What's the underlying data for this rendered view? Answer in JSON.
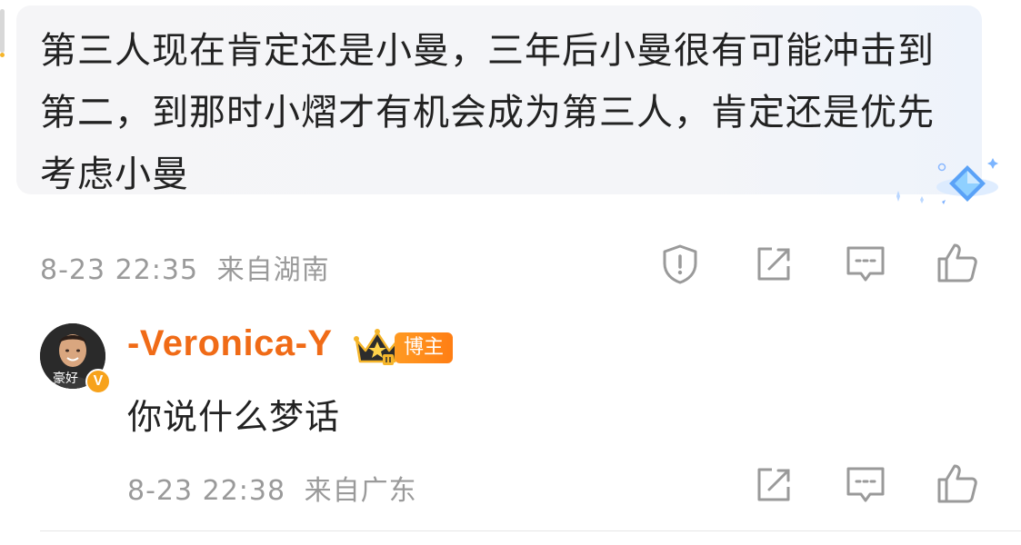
{
  "comment": {
    "text": "第三人现在肯定还是小曼，三年后小曼很有可能冲击到第二，到那时小熠才有机会成为第三人，肯定还是优先考虑小曼",
    "time": "8-23 22:35",
    "location": "来自湖南",
    "icons": [
      "report-icon",
      "share-icon",
      "reply-icon",
      "like-icon"
    ]
  },
  "reply": {
    "username": "-Veronica-Y",
    "badge": "博主",
    "avatar_overlay_text": "豪好",
    "verified_mark": "V",
    "text": "你说什么梦话",
    "time": "8-23 22:38",
    "location": "来自广东",
    "icons": [
      "share-icon",
      "reply-icon",
      "like-icon"
    ]
  },
  "colors": {
    "username": "#f06b17",
    "badge": "#ff8a1c",
    "meta": "#9a9a9a",
    "bubble": "#f5f5f7"
  }
}
